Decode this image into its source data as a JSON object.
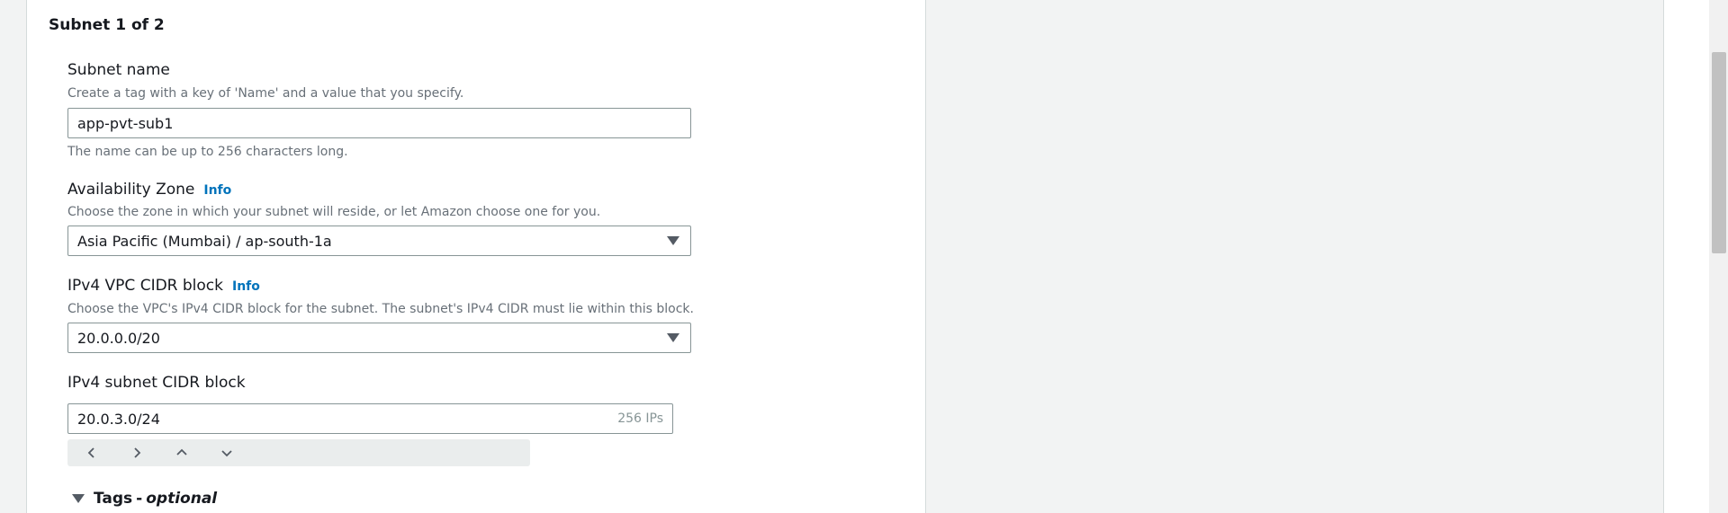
{
  "subnet": {
    "title": "Subnet 1 of 2",
    "name": {
      "label": "Subnet name",
      "description": "Create a tag with a key of 'Name' and a value that you specify.",
      "value": "app-pvt-sub1",
      "hint": "The name can be up to 256 characters long."
    },
    "availability_zone": {
      "label": "Availability Zone",
      "info": "Info",
      "description": "Choose the zone in which your subnet will reside, or let Amazon choose one for you.",
      "selected": "Asia Pacific (Mumbai) / ap-south-1a"
    },
    "vpc_cidr": {
      "label": "IPv4 VPC CIDR block",
      "info": "Info",
      "description": "Choose the VPC's IPv4 CIDR block for the subnet. The subnet's IPv4 CIDR must lie within this block.",
      "selected": "20.0.0.0/20"
    },
    "subnet_cidr": {
      "label": "IPv4 subnet CIDR block",
      "value": "20.0.3.0/24",
      "ip_count": "256 IPs"
    },
    "tags": {
      "label": "Tags",
      "dash": "-",
      "optional": "optional"
    }
  }
}
